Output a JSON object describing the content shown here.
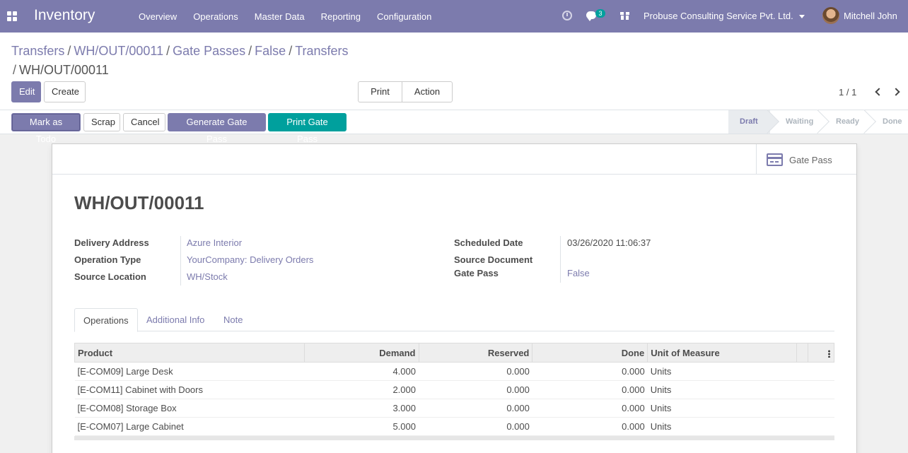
{
  "navbar": {
    "app_name": "Inventory",
    "menu": [
      "Overview",
      "Operations",
      "Master Data",
      "Reporting",
      "Configuration"
    ],
    "chat_count": "3",
    "company": "Probuse Consulting Service Pvt. Ltd.",
    "user": "Mitchell John",
    "colors": {
      "bar": "#7c7bad",
      "badge": "#00a09d"
    }
  },
  "breadcrumb": {
    "items": [
      "Transfers",
      "WH/OUT/00011",
      "Gate Passes",
      "False",
      "Transfers"
    ],
    "current": "WH/OUT/00011"
  },
  "buttons": {
    "edit": "Edit",
    "create": "Create",
    "print": "Print",
    "action": "Action"
  },
  "pager": {
    "value": "1 / 1"
  },
  "statusbar": {
    "buttons": [
      "Mark as Todo",
      "Scrap",
      "Cancel",
      "Generate Gate Pass",
      "Print Gate Pass"
    ],
    "stages": [
      "Draft",
      "Waiting",
      "Ready",
      "Done"
    ],
    "active_stage": "Draft"
  },
  "smart_button": {
    "label": "Gate Pass",
    "icon": "credit-card-icon"
  },
  "record": {
    "name": "WH/OUT/00011",
    "left": [
      {
        "label": "Delivery Address",
        "value": "Azure Interior"
      },
      {
        "label": "Operation Type",
        "value": "YourCompany: Delivery Orders"
      },
      {
        "label": "Source Location",
        "value": "WH/Stock"
      }
    ],
    "right": [
      {
        "label": "Scheduled Date",
        "value": "03/26/2020 11:06:37"
      },
      {
        "label": "Source Document",
        "value": ""
      },
      {
        "label": "Gate Pass",
        "value": "False"
      }
    ]
  },
  "tabs": [
    "Operations",
    "Additional Info",
    "Note"
  ],
  "table": {
    "headers": [
      "Product",
      "Demand",
      "Reserved",
      "Done",
      "Unit of Measure"
    ],
    "rows": [
      [
        "[E-COM09] Large Desk",
        "4.000",
        "0.000",
        "0.000",
        "Units"
      ],
      [
        "[E-COM11] Cabinet with Doors",
        "2.000",
        "0.000",
        "0.000",
        "Units"
      ],
      [
        "[E-COM08] Storage Box",
        "3.000",
        "0.000",
        "0.000",
        "Units"
      ],
      [
        "[E-COM07] Large Cabinet",
        "5.000",
        "0.000",
        "0.000",
        "Units"
      ]
    ]
  }
}
